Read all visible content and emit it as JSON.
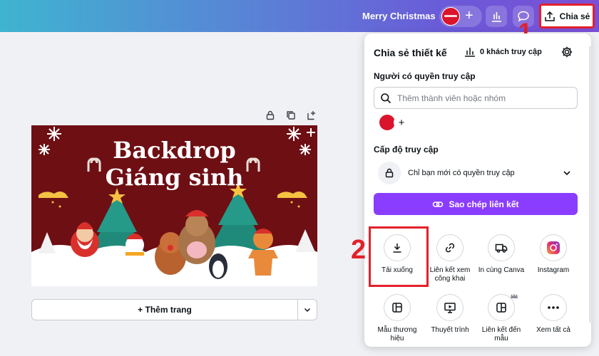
{
  "header": {
    "doc_title": "Merry Christmas",
    "share_label": "Chia sẻ",
    "icons": [
      "plus-icon",
      "insights-icon",
      "comment-icon",
      "upload-icon"
    ]
  },
  "annotations": {
    "step1": "1",
    "step2": "2"
  },
  "canvas": {
    "title_line1": "Backdrop",
    "title_line2": "Giáng sinh",
    "add_page_label": "+ Thêm trang",
    "colors": {
      "background": "#6e0f14",
      "snow": "#ffffff",
      "tree": "#1f8a7a",
      "star": "#f5c242"
    }
  },
  "share_panel": {
    "title": "Chia sẻ thiết kế",
    "visitors": "0 khách truy cập",
    "people_label": "Người có quyền truy cập",
    "search_placeholder": "Thêm thành viên hoặc nhóm",
    "access_level_label": "Cấp độ truy cập",
    "access_value": "Chỉ bạn mới có quyền truy cập",
    "copy_link_label": "Sao chép liên kết",
    "accent": "#8b3dff",
    "options": [
      {
        "label": "Tải xuống",
        "icon": "download-icon"
      },
      {
        "label": "Liên kết xem công khai",
        "icon": "link-icon"
      },
      {
        "label": "In cùng Canva",
        "icon": "truck-icon"
      },
      {
        "label": "Instagram",
        "icon": "instagram-icon"
      },
      {
        "label": "Mẫu thương hiệu",
        "icon": "brand-template-icon"
      },
      {
        "label": "Thuyết trình",
        "icon": "present-icon"
      },
      {
        "label": "Liên kết đến mẫu",
        "icon": "template-link-icon"
      },
      {
        "label": "Xem tất cả",
        "icon": "more-icon"
      }
    ]
  }
}
